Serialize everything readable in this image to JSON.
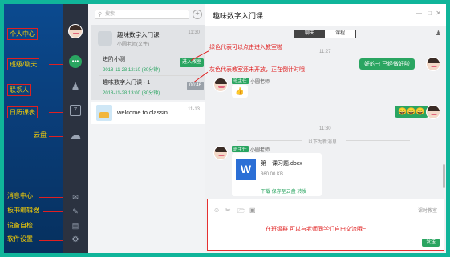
{
  "nav": {
    "items": [
      {
        "label": "个人中心",
        "boxed": true
      },
      {
        "label": "班级/聊天",
        "boxed": true
      },
      {
        "label": "联系人",
        "boxed": true
      },
      {
        "label": "日历课表",
        "boxed": true
      },
      {
        "label": "云盘",
        "boxed": false
      },
      {
        "label": "消息中心",
        "boxed": false
      },
      {
        "label": "板书编辑器",
        "boxed": false
      },
      {
        "label": "设备自检",
        "boxed": false
      },
      {
        "label": "软件设置",
        "boxed": false
      }
    ]
  },
  "list": {
    "search_placeholder": "搜索",
    "add_icon": "plus-icon",
    "course": {
      "title": "趣味数字入门课",
      "time": "11:30",
      "sub": "小圆老师(文件)",
      "lessons": [
        {
          "title": "进阶小测",
          "time": "2018-11-28 12:10 (30分钟)",
          "button": "进入教室",
          "state": "enter"
        },
        {
          "title": "趣味数字入门课 - 1",
          "time": "2018-11-28 13:00 (30分钟)",
          "button": "00:46",
          "state": "countdown"
        }
      ]
    },
    "chat": {
      "name": "welcome to classin",
      "time": "11-13"
    }
  },
  "main": {
    "title": "趣味数字入门课",
    "tabs": [
      "聊天",
      "课程"
    ],
    "active_tab": "聊天",
    "times": [
      "11:27",
      "11:30"
    ],
    "messages": [
      {
        "side": "right",
        "text": "好的~! 已经做好啦"
      },
      {
        "side": "left",
        "role": "班主任",
        "sender": "小圆老师",
        "content": "👍"
      },
      {
        "side": "right",
        "text": "😀😀😀"
      },
      {
        "side": "left",
        "role": "班主任",
        "sender": "小圆老师",
        "file": {
          "name": "第一课习题.docx",
          "size": "360.00 KB",
          "actions": "下载   保存至云盘   转发"
        }
      }
    ],
    "new_msg_divider": "以下为新消息",
    "input": {
      "send_label": "发送",
      "right_tool": "课时教室"
    }
  },
  "annotations": {
    "green_note": "绿色代表可以点击进入教室啦",
    "grey_note": "灰色代表教室还未开放，正在倒计时哦",
    "input_note": "在班级群 可以与老师同学们自由交流哦~"
  },
  "colors": {
    "accent": "#2aa561",
    "annotation": "#e02020",
    "nav": "#0b4a8f",
    "nav_label": "#ffd400"
  }
}
